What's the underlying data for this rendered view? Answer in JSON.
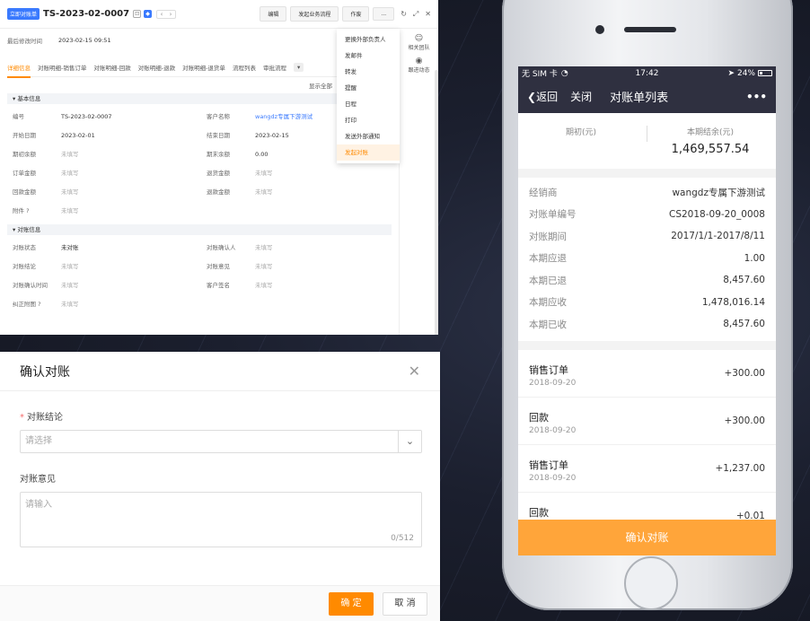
{
  "detail": {
    "tag": "立即对账单",
    "record_title": "TS-2023-02-0007",
    "nav_prev": "‹",
    "nav_next": "›",
    "toolbar": {
      "edit": "编辑",
      "start_flow": "发起业务流程",
      "void": "作废",
      "more": "..."
    },
    "last_modified_label": "最后修改时间",
    "last_modified_value": "2023-02-15 09:51",
    "tabs": [
      "详细信息",
      "对账明细-销售订单",
      "对账明细-回款",
      "对账明细-退款",
      "对账明细-退货单",
      "流程列表",
      "审批流程"
    ],
    "tab_more": "▾",
    "show_all": "显示全部",
    "section_basic": "基本信息",
    "section_recon": "对账信息",
    "placeholder_value": "未填写",
    "basic_fields": [
      {
        "label": "编号",
        "value": "TS-2023-02-0007",
        "label2": "客户名称",
        "value2": "wangdz专属下游测试"
      },
      {
        "label": "开始日期",
        "value": "2023-02-01",
        "label2": "结束日期",
        "value2": "2023-02-15"
      },
      {
        "label": "期初余额",
        "value": "未填写",
        "label2": "期末余额",
        "value2": "0.00"
      },
      {
        "label": "订单金额",
        "value": "未填写",
        "label2": "退货金额",
        "value2": "未填写"
      },
      {
        "label": "回款金额",
        "value": "未填写",
        "label2": "退款金额",
        "value2": "未填写"
      },
      {
        "label": "附件 ?",
        "value": "未填写",
        "label2": "",
        "value2": ""
      }
    ],
    "recon_fields": [
      {
        "label": "对账状态",
        "value": "未对账",
        "label2": "对账确认人",
        "value2": "未填写"
      },
      {
        "label": "对账结论",
        "value": "未填写",
        "label2": "对账意见",
        "value2": "未填写"
      },
      {
        "label": "对账确认时间",
        "value": "未填写",
        "label2": "客户签名",
        "value2": "未填写"
      },
      {
        "label": "纠正附图 ?",
        "value": "未填写",
        "label2": "",
        "value2": ""
      }
    ],
    "side": [
      {
        "icon": "☺",
        "label": "相关团队"
      },
      {
        "icon": "◉",
        "label": "跟进动态"
      }
    ],
    "dropdown": [
      "更换外部负责人",
      "发邮件",
      "转发",
      "提醒",
      "日程",
      "打印",
      "发送外部通知",
      "发起对账"
    ]
  },
  "dialog": {
    "title": "确认对账",
    "close": "✕",
    "conclusion_label": "对账结论",
    "required_mark": "*",
    "select_placeholder": "请选择",
    "opinion_label": "对账意见",
    "textarea_placeholder": "请输入",
    "counter": "0/512",
    "ok": "确 定",
    "cancel": "取 消"
  },
  "phone": {
    "carrier": "无 SIM 卡",
    "time": "17:42",
    "battery": "24%",
    "back": "返回",
    "close": "关闭",
    "title": "对账单列表",
    "menu": "•••",
    "summary": [
      {
        "label": "期初(元)",
        "value": ""
      },
      {
        "label": "本期结余(元)",
        "value": "1,469,557.54"
      }
    ],
    "info_rows": [
      {
        "k": "经销商",
        "v": "wangdz专属下游测试"
      },
      {
        "k": "对账单编号",
        "v": "CS2018-09-20_0008"
      },
      {
        "k": "对账期间",
        "v": "2017/1/1-2017/8/11"
      },
      {
        "k": "本期应退",
        "v": "1.00"
      },
      {
        "k": "本期已退",
        "v": "8,457.60"
      },
      {
        "k": "本期应收",
        "v": "1,478,016.14"
      },
      {
        "k": "本期已收",
        "v": "8,457.60"
      }
    ],
    "transactions": [
      {
        "type": "销售订单",
        "date": "2018-09-20",
        "amount": "+300.00"
      },
      {
        "type": "回款",
        "date": "2018-09-20",
        "amount": "+300.00"
      },
      {
        "type": "销售订单",
        "date": "2018-09-20",
        "amount": "+1,237.00"
      },
      {
        "type": "回款",
        "date": "",
        "amount": "+0.01"
      }
    ],
    "confirm": "确认对账"
  },
  "colors": {
    "accent": "#ff8a00",
    "link": "#3a7afe",
    "phone_bar": "#2f3040",
    "phone_cta": "#ffa53a"
  }
}
